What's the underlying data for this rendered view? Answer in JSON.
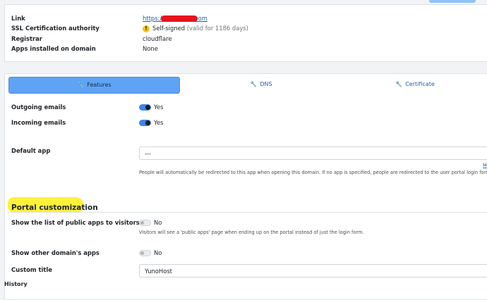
{
  "info": {
    "rows": [
      {
        "label": "Link",
        "value_prefix": "https://",
        "value_suffix": "com"
      },
      {
        "label": "SSL Certification authority",
        "value": "Self-signed",
        "note": "(valid for 1186 days)"
      },
      {
        "label": "Registrar",
        "value": "cloudflare"
      },
      {
        "label": "Apps installed on domain",
        "value": "None"
      }
    ]
  },
  "tabs": [
    {
      "label": "Features",
      "icon": "wrench-icon"
    },
    {
      "label": "DNS",
      "icon": "wrench-icon"
    },
    {
      "label": "Certificate",
      "icon": "wrench-icon"
    }
  ],
  "features": {
    "outgoing_label": "Outgoing emails",
    "outgoing_value": "Yes",
    "incoming_label": "Incoming emails",
    "incoming_value": "Yes",
    "default_app_label": "Default app",
    "default_app_value": "---",
    "default_app_help": "People will automatically be redirected to this app when opening this domain. If no app is specified, people are redirected to the user portal login form.",
    "default_app_link_fragment": "M"
  },
  "portal": {
    "section_title": "Portal customization",
    "public_apps_label": "Show the list of public apps to visitors",
    "public_apps_value": "No",
    "public_apps_help": "Visitors will see a 'public apps' page when ending up on the portal instead of just the login form.",
    "other_domains_label": "Show other domain's apps",
    "other_domains_value": "No",
    "custom_title_label": "Custom title",
    "custom_title_value": "YunoHost"
  },
  "footer": {
    "history_label": "History"
  },
  "colors": {
    "accent": "#5fa3f5",
    "toggle_on": "#3d85e6",
    "highlight": "#fff13a",
    "redaction": "#e8141d",
    "warning": "#f5c518"
  }
}
